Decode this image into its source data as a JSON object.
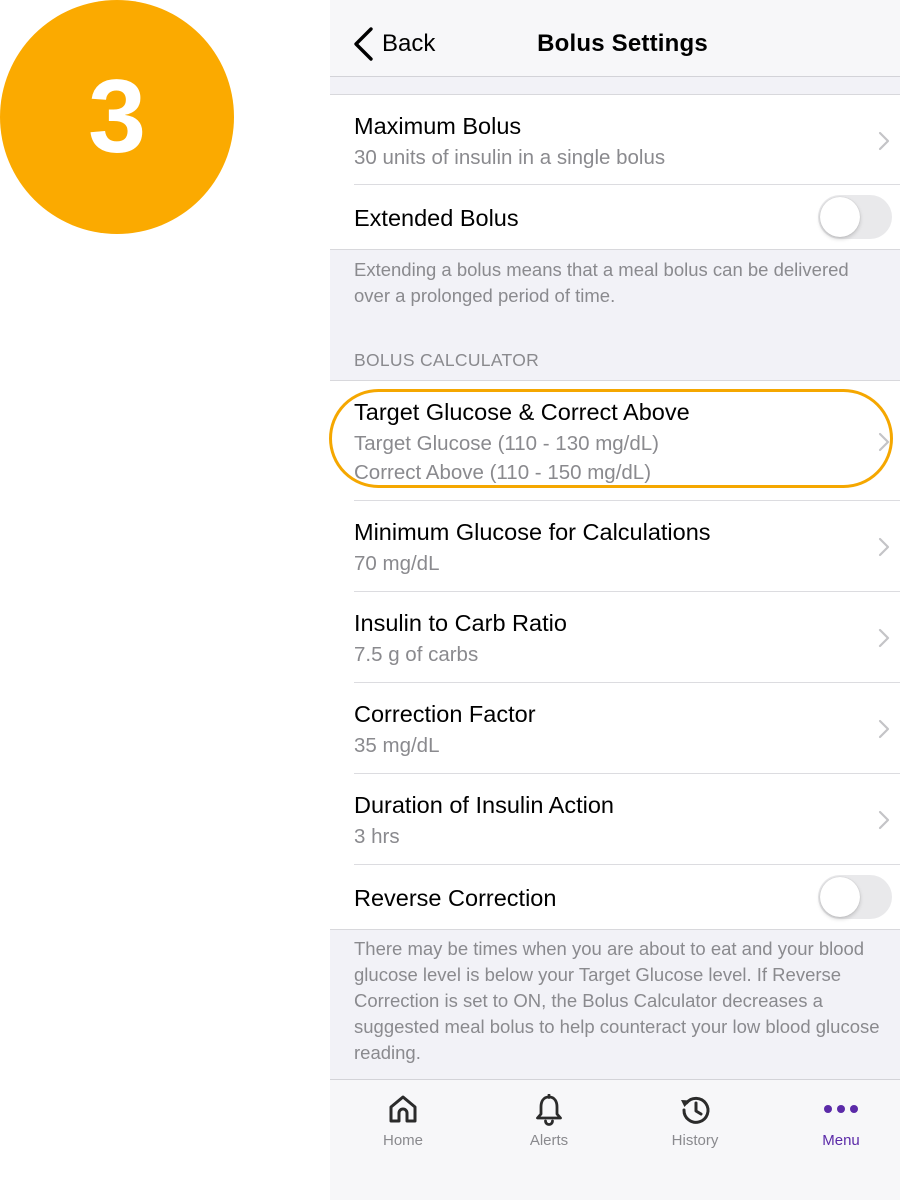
{
  "step_badge": "3",
  "nav": {
    "back_label": "Back",
    "title": "Bolus Settings"
  },
  "rows": {
    "max_bolus": {
      "title": "Maximum Bolus",
      "subtitle": "30 units of insulin in a single bolus"
    },
    "extended_bolus": {
      "title": "Extended Bolus",
      "enabled": false
    },
    "extended_note": "Extending a bolus means that a meal bolus can be delivered over a prolonged period of time.",
    "section_header": "BOLUS CALCULATOR",
    "target_glucose": {
      "title": "Target Glucose & Correct Above",
      "line1": "Target Glucose (110 - 130 mg/dL)",
      "line2": "Correct Above (110 - 150 mg/dL)"
    },
    "min_glucose": {
      "title": "Minimum Glucose for Calculations",
      "subtitle": "70 mg/dL"
    },
    "carb_ratio": {
      "title": "Insulin to Carb Ratio",
      "subtitle": "7.5 g of carbs"
    },
    "correction_factor": {
      "title": "Correction Factor",
      "subtitle": "35 mg/dL"
    },
    "insulin_action": {
      "title": "Duration of Insulin Action",
      "subtitle": "3 hrs"
    },
    "reverse_correction": {
      "title": "Reverse Correction",
      "enabled": false
    },
    "reverse_note": "There may be times when you are about to eat and your blood glucose level is below your Target Glucose level. If Reverse Correction is set to ON, the Bolus Calculator decreases a suggested meal bolus to help counteract your low blood glucose reading."
  },
  "tabs": [
    {
      "label": "Home",
      "icon": "home-icon"
    },
    {
      "label": "Alerts",
      "icon": "bell-icon"
    },
    {
      "label": "History",
      "icon": "history-icon"
    },
    {
      "label": "Menu",
      "icon": "more-dots-icon",
      "active": true
    }
  ],
  "colors": {
    "badge": "#FBAA00",
    "highlight": "#F5A700",
    "active_tab": "#5B2AA8",
    "secondary_text": "#8A8A8E",
    "background": "#F2F2F7"
  }
}
